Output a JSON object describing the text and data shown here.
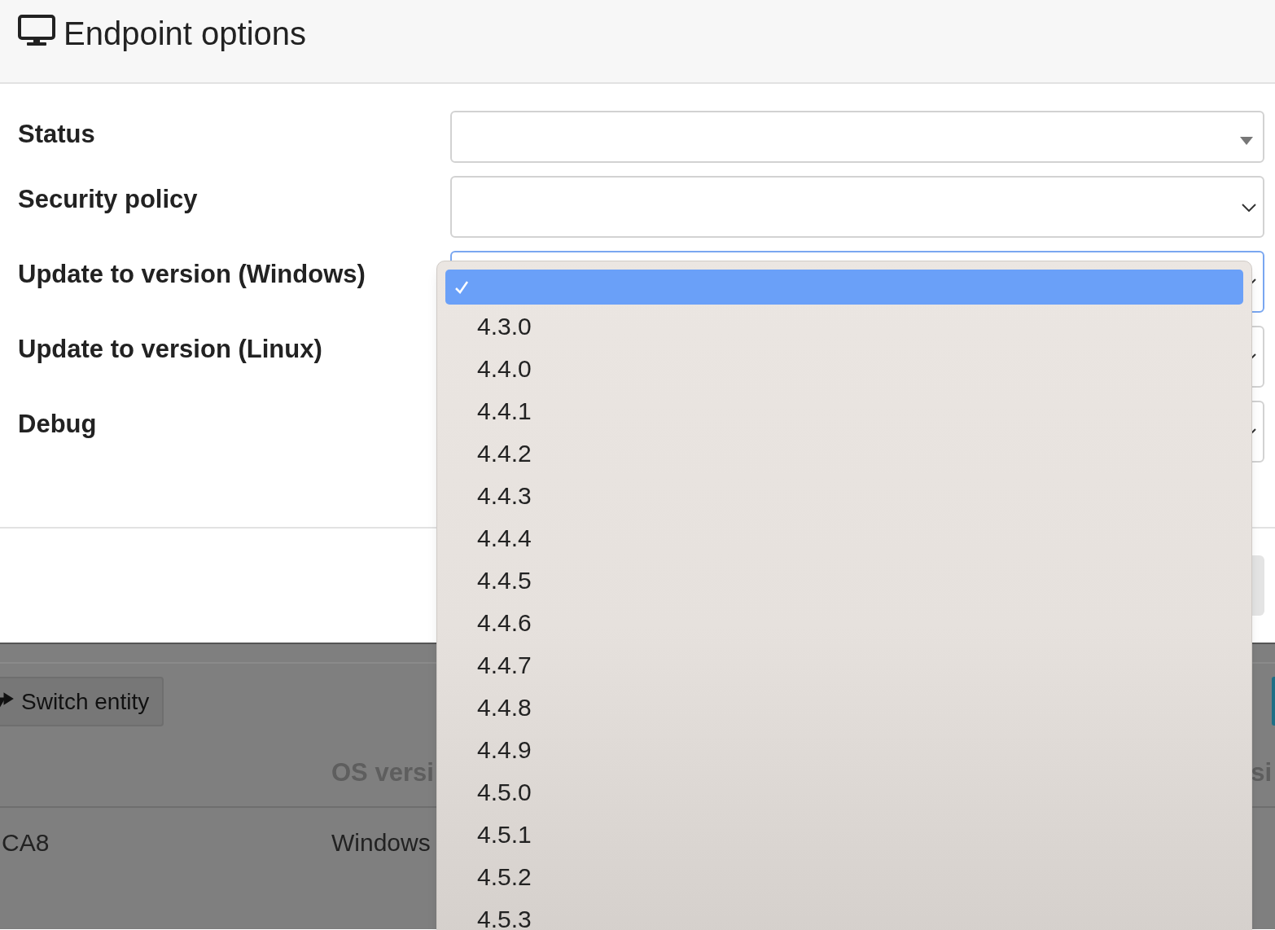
{
  "header": {
    "title": "Endpoint options"
  },
  "fields": [
    {
      "label": "Status",
      "kind": "select2",
      "focused": false
    },
    {
      "label": "Security policy",
      "kind": "native",
      "focused": false
    },
    {
      "label": "Update to version (Windows)",
      "kind": "native",
      "focused": true
    },
    {
      "label": "Update to version (Linux)",
      "kind": "native",
      "focused": false
    },
    {
      "label": "Debug",
      "kind": "native",
      "focused": false
    }
  ],
  "dropdown": {
    "options": [
      {
        "selected": true
      },
      {
        "label": "4.3.0",
        "selected": false
      },
      {
        "label": "4.4.0",
        "selected": false
      },
      {
        "label": "4.4.1",
        "selected": false
      },
      {
        "label": "4.4.2",
        "selected": false
      },
      {
        "label": "4.4.3",
        "selected": false
      },
      {
        "label": "4.4.4",
        "selected": false
      },
      {
        "label": "4.4.5",
        "selected": false
      },
      {
        "label": "4.4.6",
        "selected": false
      },
      {
        "label": "4.4.7",
        "selected": false
      },
      {
        "label": "4.4.8",
        "selected": false
      },
      {
        "label": "4.4.9",
        "selected": false
      },
      {
        "label": "4.5.0",
        "selected": false
      },
      {
        "label": "4.5.1",
        "selected": false
      },
      {
        "label": "4.5.2",
        "selected": false
      },
      {
        "label": "4.5.3",
        "selected": false
      }
    ]
  },
  "background_page": {
    "switch_button": "Switch entity",
    "columns": [
      "",
      "OS versi",
      "si"
    ],
    "rows": [
      [
        "CA8",
        "Windows"
      ]
    ]
  }
}
